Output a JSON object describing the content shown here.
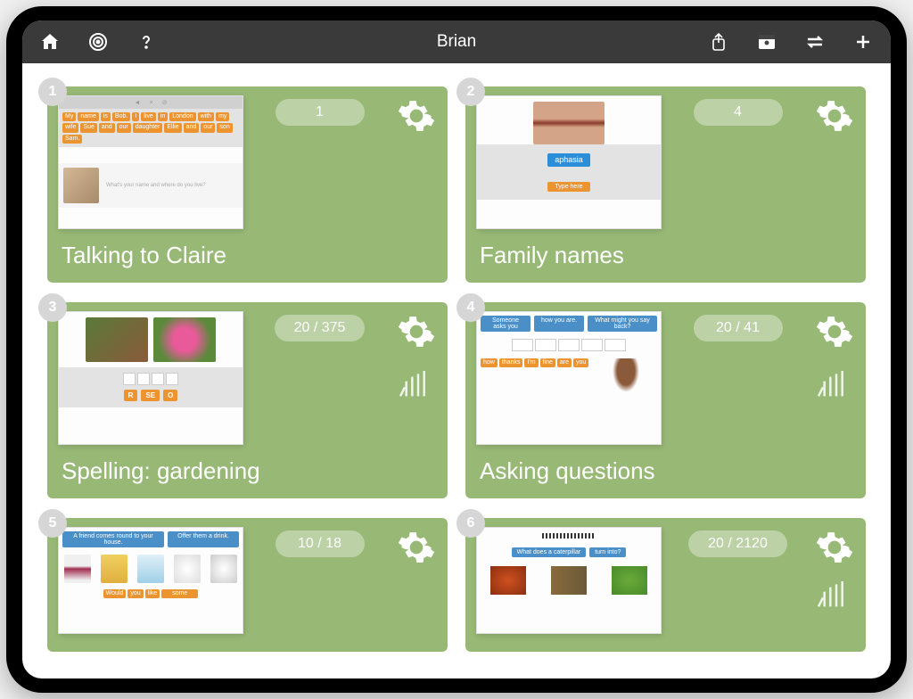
{
  "header": {
    "title": "Brian"
  },
  "cards": [
    {
      "num": "1",
      "title": "Talking to Claire",
      "count": "1",
      "has_bars": false,
      "thumb_words": [
        "My",
        "name",
        "is",
        "Bob.",
        "I",
        "live",
        "in",
        "London",
        "with",
        "my",
        "wife",
        "Sue",
        "and",
        "our",
        "daughter",
        "Ellie",
        "and",
        "our",
        "son",
        "Sam."
      ]
    },
    {
      "num": "2",
      "title": "Family names",
      "count": "4",
      "has_bars": false,
      "thumb_label": "aphasia",
      "thumb_btn": "Type here"
    },
    {
      "num": "3",
      "title": "Spelling: gardening",
      "count": "20 / 375",
      "has_bars": true,
      "letters": [
        "R",
        "SE",
        "O"
      ]
    },
    {
      "num": "4",
      "title": "Asking questions",
      "count": "20 / 41",
      "has_bars": true,
      "bluebars": [
        "Someone asks you",
        "how you are.",
        "What might you say back?"
      ],
      "words": [
        "how",
        "thanks",
        "I'm",
        "fine",
        "are",
        "you"
      ]
    },
    {
      "num": "5",
      "title": "",
      "count": "10 / 18",
      "has_bars": false,
      "bluebars": [
        "A friend comes round to your house.",
        "Offer them a drink."
      ],
      "words": [
        "Would",
        "you",
        "like",
        "some"
      ]
    },
    {
      "num": "6",
      "title": "",
      "count": "20 / 2120",
      "has_bars": true,
      "bluebars": [
        "What does a caterpillar",
        "turn into?"
      ]
    }
  ]
}
